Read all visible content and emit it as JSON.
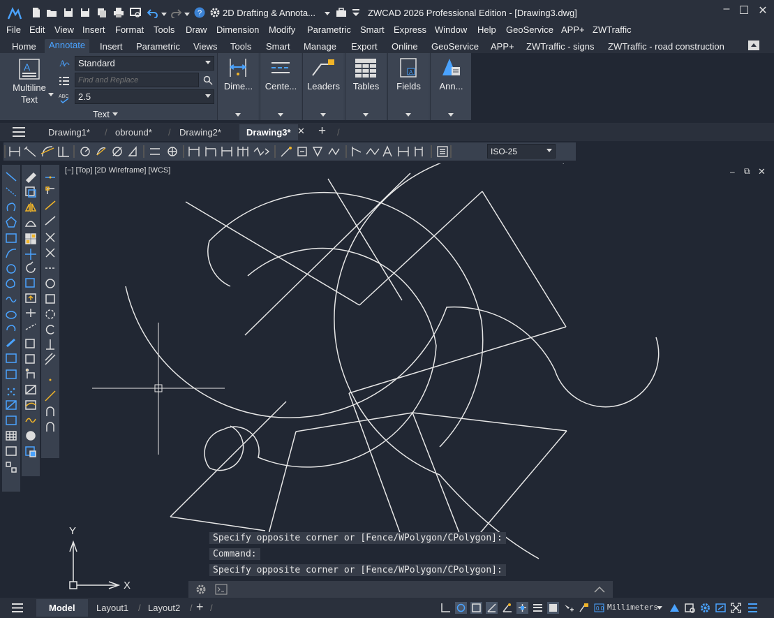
{
  "title": "ZWCAD 2026 Professional Edition - [Drawing3.dwg]",
  "workspace": "2D Drafting & Annota...",
  "menu": [
    "File",
    "Edit",
    "View",
    "Insert",
    "Format",
    "Tools",
    "Draw",
    "Dimension",
    "Modify",
    "Parametric",
    "Smart",
    "Express",
    "Window",
    "Help",
    "GeoService",
    "APP+",
    "ZWTraffic"
  ],
  "ribbon_tabs": [
    "Home",
    "Annotate",
    "Insert",
    "Parametric",
    "Views",
    "Tools",
    "Smart",
    "Manage",
    "Export",
    "Online",
    "GeoService",
    "APP+",
    "ZWTraffic - signs",
    "ZWTraffic - road construction"
  ],
  "ribbon": {
    "multiline_text_l1": "Multiline",
    "multiline_text_l2": "Text",
    "text_style": "Standard",
    "find_placeholder": "Find and Replace",
    "text_height": "2.5",
    "text_panel": "Text",
    "panels": [
      "Dime...",
      "Cente...",
      "Leaders",
      "Tables",
      "Fields",
      "Ann..."
    ]
  },
  "doc_tabs": [
    "Drawing1*",
    "obround*",
    "Drawing2*",
    "Drawing3*"
  ],
  "dim_style": "ISO-25",
  "viewport_label": "[−] [Top] [2D Wireframe] [WCS]",
  "command_lines": [
    "Specify opposite corner or [Fence/WPolygon/CPolygon]:",
    "Command:",
    "Specify opposite corner or [Fence/WPolygon/CPolygon]:"
  ],
  "ucs": {
    "x": "X",
    "y": "Y"
  },
  "layout_tabs": [
    "Model",
    "Layout1",
    "Layout2"
  ],
  "units": "Millimeters",
  "colors": {
    "accent": "#4aa3ff",
    "bg": "#212733",
    "panel": "#39414f",
    "titlebar": "#2a303c"
  }
}
